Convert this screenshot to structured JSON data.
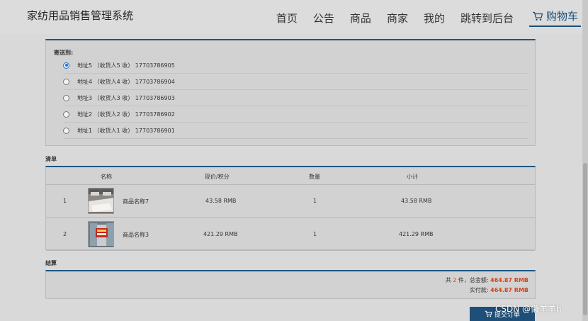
{
  "header": {
    "brand": "家纺用品销售管理系统",
    "nav": [
      "首页",
      "公告",
      "商品",
      "商家",
      "我的",
      "跳转到后台"
    ],
    "cart_label": "购物车",
    "cart_icon": "cart-icon"
  },
  "address": {
    "label": "寄送到:",
    "items": [
      {
        "text": "地址5 （收货人5 收） 17703786905",
        "selected": true
      },
      {
        "text": "地址4 （收货人4 收） 17703786904",
        "selected": false
      },
      {
        "text": "地址3 （收货人3 收） 17703786903",
        "selected": false
      },
      {
        "text": "地址2 （收货人2 收） 17703786902",
        "selected": false
      },
      {
        "text": "地址1 （收货人1 收） 17703786901",
        "selected": false
      }
    ]
  },
  "list": {
    "title": "清单",
    "columns": [
      "名称",
      "现价/积分",
      "数量",
      "小计"
    ],
    "rows": [
      {
        "index": "1",
        "name": "商品名称7",
        "price": "43.58 RMB",
        "qty": "1",
        "subtotal": "43.58 RMB"
      },
      {
        "index": "2",
        "name": "商品名称3",
        "price": "421.29 RMB",
        "qty": "1",
        "subtotal": "421.29 RMB"
      }
    ]
  },
  "settle": {
    "title": "结算",
    "count_prefix": "共",
    "count": "2",
    "count_suffix": "件，总金额:",
    "total": "464.87 RMB",
    "paid_label": "实付款:",
    "paid": "464.87 RMB"
  },
  "submit": {
    "label": "提交订单",
    "icon": "cart-icon"
  },
  "watermark": "CSDN @懒羊羊h",
  "colors": {
    "accent": "#1f5580",
    "price_red": "#d9421b",
    "radio_blue": "#1976d2"
  }
}
